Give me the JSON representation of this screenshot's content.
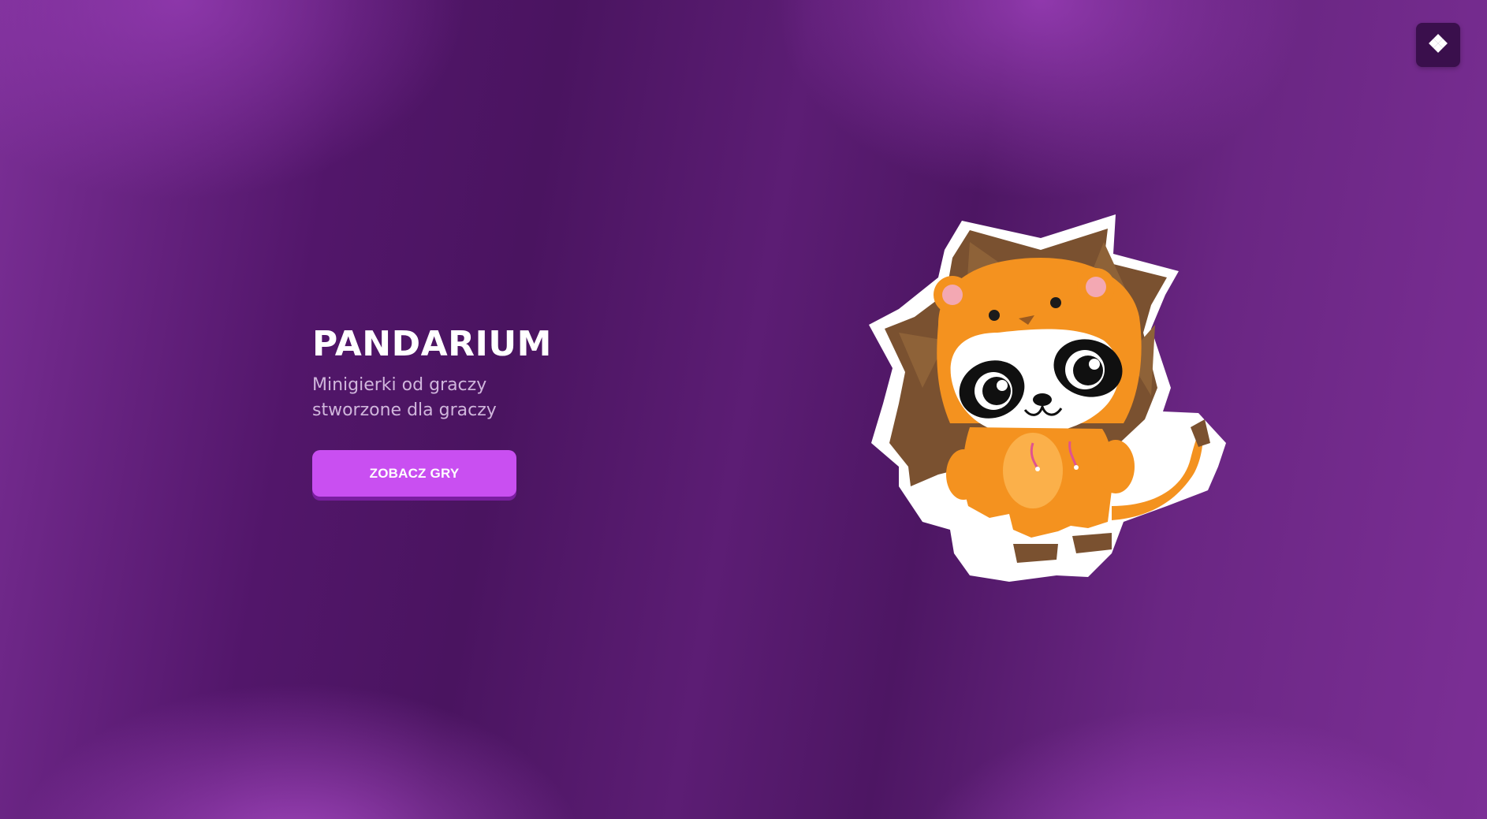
{
  "hero": {
    "title": "PANDARIUM",
    "subtitle": "Minigierki od graczy stworzone dla graczy",
    "cta_label": "ZOBACZ GRY"
  },
  "corner_button": {
    "icon": "diamond-grid-icon"
  },
  "mascot": {
    "icon": "panda-in-lion-costume-illustration"
  },
  "colors": {
    "background_dark": "#4a1460",
    "background_light": "#9b3fbf",
    "accent": "#c94ff1",
    "accent_shadow": "#7a1ea0",
    "title": "#ffffff",
    "subtitle": "#d0b6dc",
    "corner_button_bg": "#3a0f4c"
  }
}
